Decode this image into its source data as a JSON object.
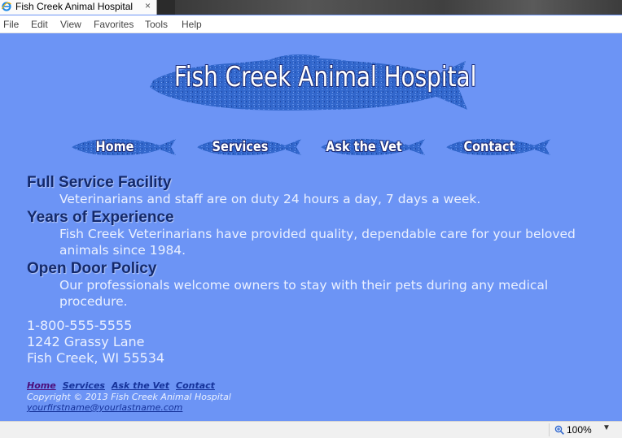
{
  "browser": {
    "tab_title": "Fish Creek Animal Hospital",
    "tab_close": "×",
    "menu": [
      "File",
      "Edit",
      "View",
      "Favorites",
      "Tools",
      "Help"
    ],
    "zoom": "100%",
    "zoom_dropdown": "▼"
  },
  "site": {
    "logo_text": "Fish Creek Animal Hospital",
    "nav": [
      {
        "label": "Home"
      },
      {
        "label": "Services"
      },
      {
        "label": "Ask the Vet"
      },
      {
        "label": "Contact"
      }
    ],
    "features": [
      {
        "heading": "Full Service Facility",
        "text": "Veterinarians and staff are on duty 24 hours a day, 7 days a week."
      },
      {
        "heading": "Years of Experience",
        "text": "Fish Creek Veterinarians have provided quality, dependable care for your beloved animals since 1984."
      },
      {
        "heading": "Open Door Policy",
        "text": "Our professionals welcome owners to stay with their pets during any medical procedure."
      }
    ],
    "contact": {
      "phone": "1-800-555-5555",
      "street": "1242 Grassy Lane",
      "city": "Fish Creek, WI 55534"
    },
    "footer": {
      "links": [
        "Home",
        "Services",
        "Ask the Vet",
        "Contact"
      ],
      "copyright": "Copyright © 2013 Fish Creek Animal Hospital",
      "email": "yourfirstname@yourlastname.com"
    }
  },
  "colors": {
    "page_bg": "#6c94f5",
    "fish": "#2f62c9",
    "heading": "#13296b",
    "link": "#15329a",
    "visited_link": "#4b0d7a"
  }
}
